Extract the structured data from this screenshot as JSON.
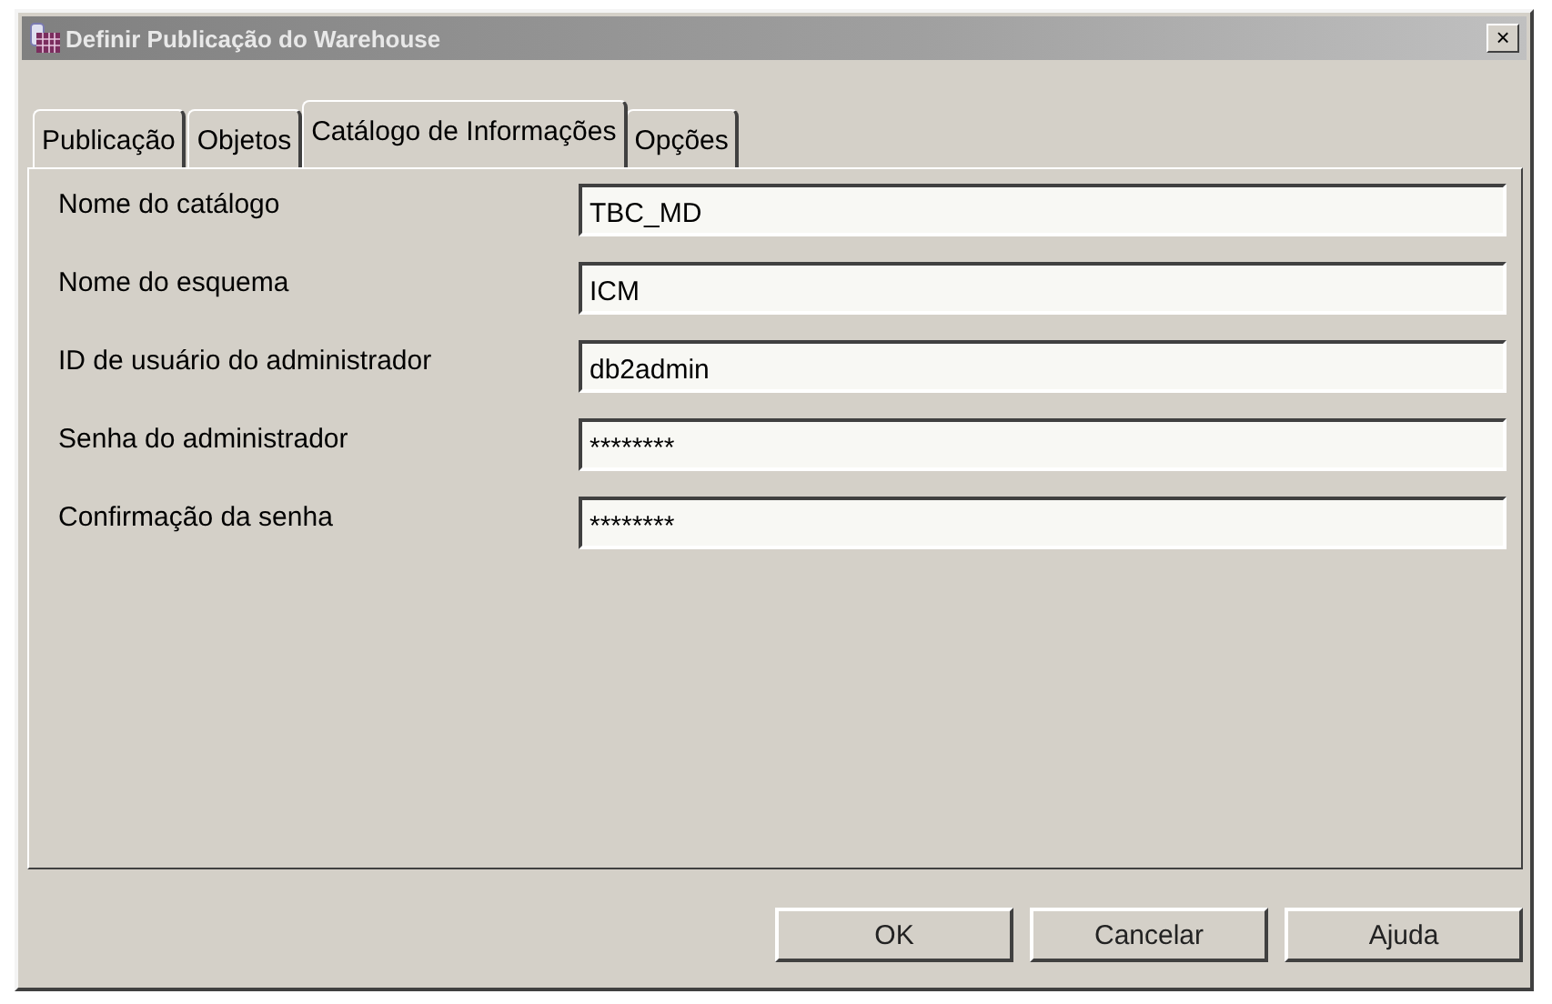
{
  "window": {
    "title": "Definir Publicação do Warehouse",
    "close": "×"
  },
  "tabs": [
    {
      "label": "Publicação",
      "selected": false
    },
    {
      "label": "Objetos",
      "selected": false
    },
    {
      "label": "Catálogo de Informações",
      "selected": true
    },
    {
      "label": "Opções",
      "selected": false
    }
  ],
  "fields": [
    {
      "label": "Nome do catálogo",
      "value": "TBC_MD"
    },
    {
      "label": "Nome do esquema",
      "value": "ICM"
    },
    {
      "label": "ID de usuário do administrador",
      "value": "db2admin"
    },
    {
      "label": "Senha do administrador",
      "value": "********"
    },
    {
      "label": "Confirmação da senha",
      "value": "********"
    }
  ],
  "buttons": [
    "OK",
    "Cancelar",
    "Ajuda"
  ]
}
